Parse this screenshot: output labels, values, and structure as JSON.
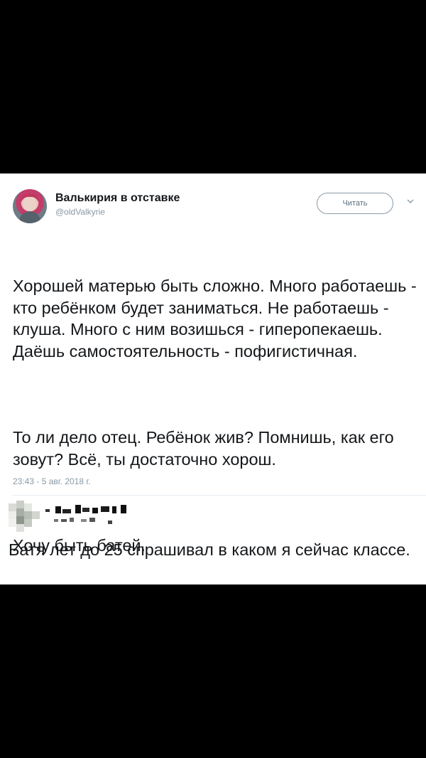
{
  "tweet": {
    "display_name": "Валькирия в отставке",
    "handle": "@oldValkyrie",
    "follow_label": "Читать",
    "paragraphs": [
      "Хорошей матерью быть сложно. Много работаешь - кто ребёнком будет заниматься. Не работаешь - клуша. Много с ним возишься - гиперопекаешь. Даёшь самостоятельность - пофигистичная.",
      "То ли дело отец. Ребёнок жив? Помнишь, как его зовут? Всё, ты достаточно хорош.",
      "Хочу быть батей."
    ],
    "timestamp": "23:43 - 5 авг. 2018 г."
  },
  "reply": {
    "text": "Батя лет до 25 спрашивал в каком я сейчас классе."
  },
  "icons": {
    "avatar": "profile-photo",
    "more": "chevron-down-icon",
    "reply_avatar": "pixelated-profile-photo",
    "reply_name": "pixelated-username"
  }
}
